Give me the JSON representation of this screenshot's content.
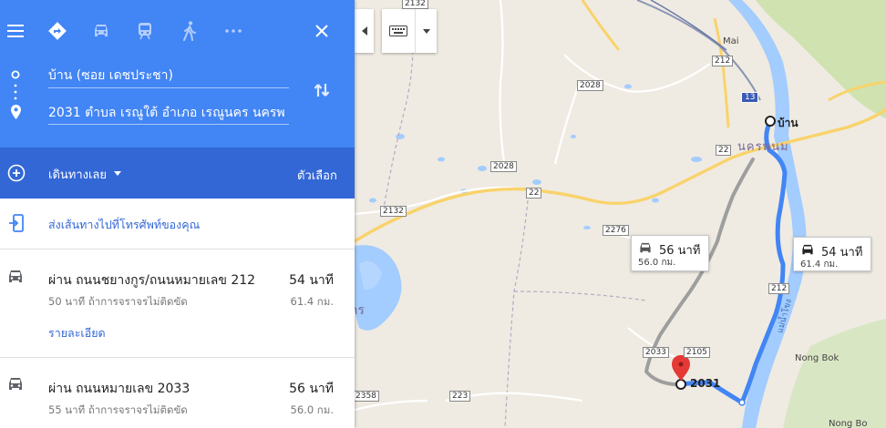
{
  "modes": {
    "menu": "menu-icon",
    "best": "directions-icon",
    "drive": "car-icon",
    "transit": "train-icon",
    "walk": "walk-icon",
    "more": "more-icon",
    "close": "close-icon",
    "accent": "#4285f4"
  },
  "origin": {
    "value": "บ้าน (ซอย เดชประชา)"
  },
  "destination": {
    "value": "2031 ตำบล เรณูใต้ อำเภอ เรณูนคร นครพ"
  },
  "options": {
    "leave": "เดินทางเลย",
    "settings": "ตัวเลือก"
  },
  "send": {
    "label": "ส่งเส้นทางไปที่โทรศัพท์ของคุณ"
  },
  "routes": [
    {
      "via": "ผ่าน ถนนชยางกูร/ถนนหมายเลข 212",
      "time": "54 นาที",
      "traffic": "50 นาที ถ้าการจราจรไม่ติดขัด",
      "distance": "61.4 กม.",
      "details": "รายละเอียด"
    },
    {
      "via": "ผ่าน ถนนหมายเลข 2033",
      "time": "56 นาที",
      "traffic": "55 นาที ถ้าการจราจรไม่ติดขัด",
      "distance": "56.0 กม."
    }
  ],
  "map": {
    "place_labels": {
      "mai": "Mai",
      "nakhon": "นครพนม",
      "nongbok": "Nong Bok",
      "kr": "คร",
      "bottom": "Nong Bo",
      "lao": "แม่น้ำโขง"
    },
    "road_numbers": [
      "2132",
      "212",
      "2028",
      "13",
      "2028",
      "22",
      "22",
      "2132",
      "2276",
      "212",
      "2033",
      "2105",
      "223",
      "2358"
    ],
    "origin_label": "บ้าน",
    "dest_label": "2031",
    "info_primary": {
      "time": "54 นาที",
      "distance": "61.4 กม."
    },
    "info_alt": {
      "time": "56 นาที",
      "distance": "56.0 กม."
    }
  }
}
